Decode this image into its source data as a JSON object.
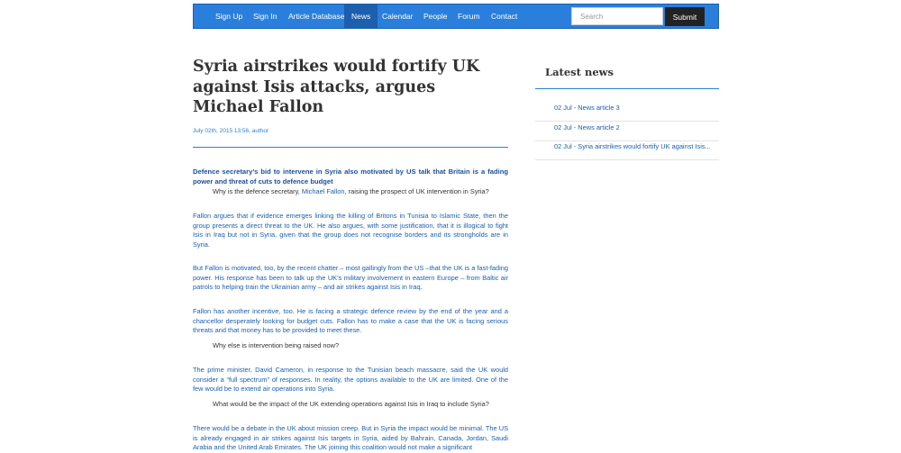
{
  "nav": {
    "items": [
      "Sign Up",
      "Sign In",
      "Article Database",
      "News",
      "Calendar",
      "People",
      "Forum",
      "Contact"
    ],
    "active": "News",
    "search_placeholder": "Search",
    "submit_label": "Submit"
  },
  "article": {
    "title": "Syria airstrikes would fortify UK against Isis attacks, argues Michael Fallon",
    "meta": "July 02th, 2015 13:56, author",
    "lead": "Defence secretary’s bid to intervene in Syria also motivated by US talk that Britain is a fading power and threat of cuts to defence budget",
    "q1_prefix": "Why is the defence secretary, ",
    "q1_link": "Michael Fallon",
    "q1_suffix": ", raising the prospect of UK intervention in Syria?",
    "p1": "Fallon argues that if evidence emerges linking the killing of Britons in Tunisia to Islamic State, then the group presents a direct threat to the UK. He also argues, with some justification, that it is illogical to fight Isis in Iraq but not in Syria, given that the group does not recognise borders and its strongholds are in Syria.",
    "p2": "But Fallon is motivated, too, by the recent chatter – most gallingly from the US –that the UK is a fast-fading power. His response has been to talk up the UK’s military involvement in eastern Europe – from Baltic air patrols to helping train the Ukrainian army – and air strikes against Isis in Iraq.",
    "p3": "Fallon has another incentive, too. He is facing a strategic defence review by the end of the year and a chancellor desperately looking for budget cuts. Fallon has to make a case that the UK is facing serious threats and that money has to be provided to meet these.",
    "q2": "Why else is intervention being raised now?",
    "p4": "The prime minister, David Cameron, in response to the Tunisian beach massacre, said the UK would consider a “full spectrum” of responses. In reality, the options available to the UK are limited. One of the few would be to extend air operations into Syria.",
    "q3": "What would be the impact of the UK extending operations against Isis in Iraq to include Syria?",
    "p5": "There would be a debate in the UK about mission creep. But in Syria the impact would be minimal. The US is already engaged in air strikes against Isis targets in Syria, aided by Bahrain, Canada, Jordan, Saudi Arabia and the United Arab Emirates. The UK joining this coalition would not make a significant"
  },
  "sidebar": {
    "title": "Latest news",
    "items": [
      "02 Jul - News article 3",
      "02 Jul - News article 2",
      "02 Jul - Syria airstrikes would fortify UK against Isis..."
    ]
  }
}
